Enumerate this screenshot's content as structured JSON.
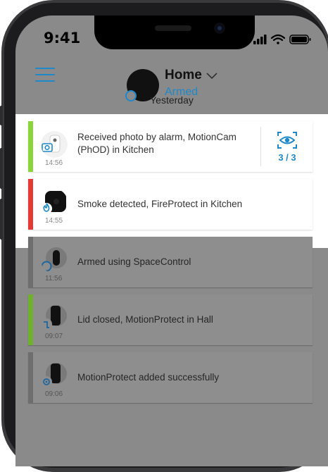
{
  "status_bar": {
    "time": "9:41",
    "signal_icon": "signal-bars-icon",
    "wifi_icon": "wifi-icon",
    "battery_icon": "battery-icon"
  },
  "header": {
    "menu_icon": "hamburger-menu-icon",
    "hub_name": "Home",
    "hub_status": "Armed",
    "chevron_icon": "chevron-down-icon",
    "accent_color": "#1e88c8"
  },
  "feed": {
    "day_label": "Yesterday",
    "events": [
      {
        "text": "Received photo by alarm, MotionCam (PhOD) in Kitchen",
        "time": "14:56",
        "accent": "#8bd43a",
        "icon": "camera-icon",
        "photo_count": "3 / 3",
        "photo_icon": "eye-scan-icon"
      },
      {
        "text": "Smoke detected, FireProtect in Kitchen",
        "time": "14:55",
        "accent": "#e53935",
        "icon": "fire-icon"
      },
      {
        "text": "Armed using SpaceControl",
        "time": "11:56",
        "accent": "#6e6e6e",
        "icon": "armed-circle-icon"
      },
      {
        "text": "Lid closed, MotionProtect in Hall",
        "time": "09:07",
        "accent": "#6fb12c",
        "icon": "lid-icon"
      },
      {
        "text": "MotionProtect added successfully",
        "time": "09:06",
        "accent": "#6e6e6e",
        "icon": "settings-icon"
      }
    ]
  }
}
